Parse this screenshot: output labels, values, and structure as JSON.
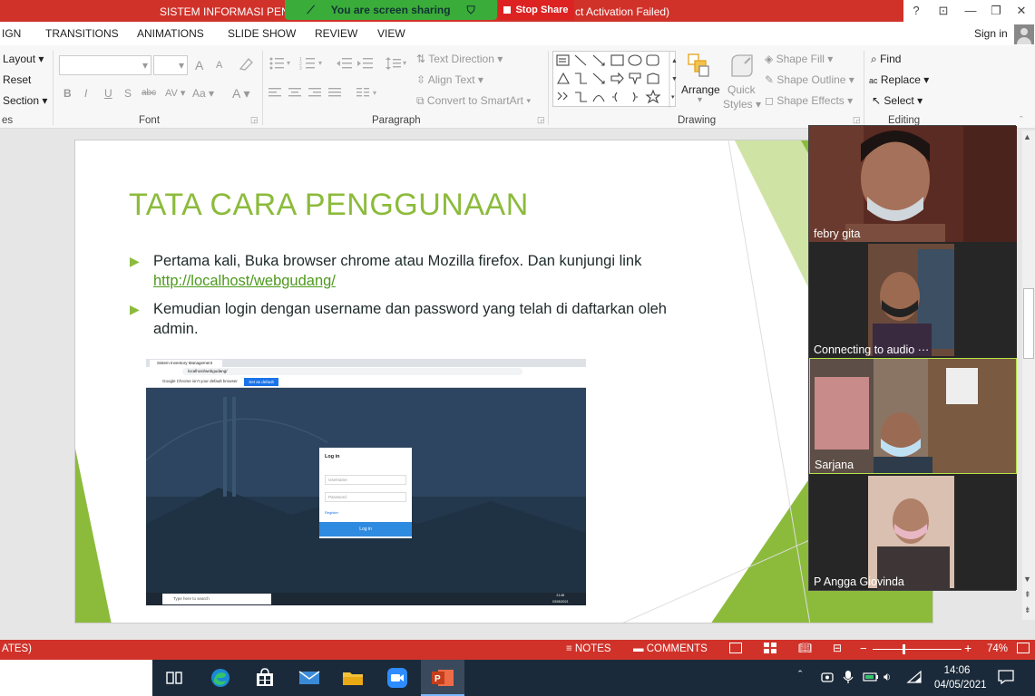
{
  "title_bar": {
    "title_left": "SISTEM INFORMASI PENGI",
    "title_right": "ct Activation Failed)",
    "share_status": "You are screen sharing",
    "stop_share": "Stop Share",
    "help": "?",
    "restore_ribbon": "⊡",
    "minimize": "—",
    "maximize": "❐",
    "close": "✕"
  },
  "ribbon_tabs": [
    "IGN",
    "TRANSITIONS",
    "ANIMATIONS",
    "SLIDE SHOW",
    "REVIEW",
    "VIEW"
  ],
  "sign_in": "Sign in",
  "slides_group": {
    "layout": "Layout",
    "reset": "Reset",
    "section": "Section",
    "label": "es"
  },
  "font_group": {
    "label": "Font",
    "bold": "B",
    "italic": "I",
    "underline": "U",
    "shadow": "S",
    "strike": "abc",
    "spacing": "AV",
    "case": "Aa",
    "color": "A",
    "grow": "A",
    "shrink": "A"
  },
  "paragraph_group": {
    "label": "Paragraph",
    "text_direction": "Text Direction",
    "align_text": "Align Text",
    "smartart": "Convert to SmartArt"
  },
  "drawing_group": {
    "label": "Drawing",
    "arrange": "Arrange",
    "quick": "Quick",
    "styles": "Styles",
    "shape_fill": "Shape Fill",
    "shape_outline": "Shape Outline",
    "shape_effects": "Shape Effects"
  },
  "editing_group": {
    "label": "Editing",
    "find": "Find",
    "replace": "Replace",
    "select": "Select"
  },
  "slide": {
    "title": "TATA CARA PENGGUNAAN",
    "bullet1_text": "Pertama kali, Buka browser chrome atau Mozilla firefox. Dan kunjungi link",
    "bullet1_link": "http://localhost/webgudang/",
    "bullet2_line1": "Kemudian login dengan username dan password yang telah di daftarkan oleh",
    "bullet2_line2": "admin."
  },
  "screenshot": {
    "tab_title": "Sistem Inventory Management",
    "url": "localhost/webgudang/",
    "default_notice": "Google Chrome isn't your default browser",
    "set_default": "Set as default",
    "login_title": "Log in",
    "username_placeholder": "Username",
    "password_placeholder": "Password",
    "register": "Register",
    "login_button": "Log in",
    "search": "Type here to search",
    "time": "21:48",
    "date": "03/05/2021"
  },
  "participants": [
    {
      "name": "febry gita"
    },
    {
      "name": "Connecting to audio"
    },
    {
      "name": "Sarjana"
    },
    {
      "name": "P Angga Giovinda"
    }
  ],
  "status_bar": {
    "left": "ATES)",
    "notes": "NOTES",
    "comments": "COMMENTS",
    "zoom": "74%"
  },
  "taskbar": {
    "time": "14:06",
    "date": "04/05/2021"
  },
  "colors": {
    "accent": "#d0322a",
    "title_green": "#8cbb3c",
    "share_green": "#3aac3a",
    "taskbar": "#1b2a3a"
  }
}
